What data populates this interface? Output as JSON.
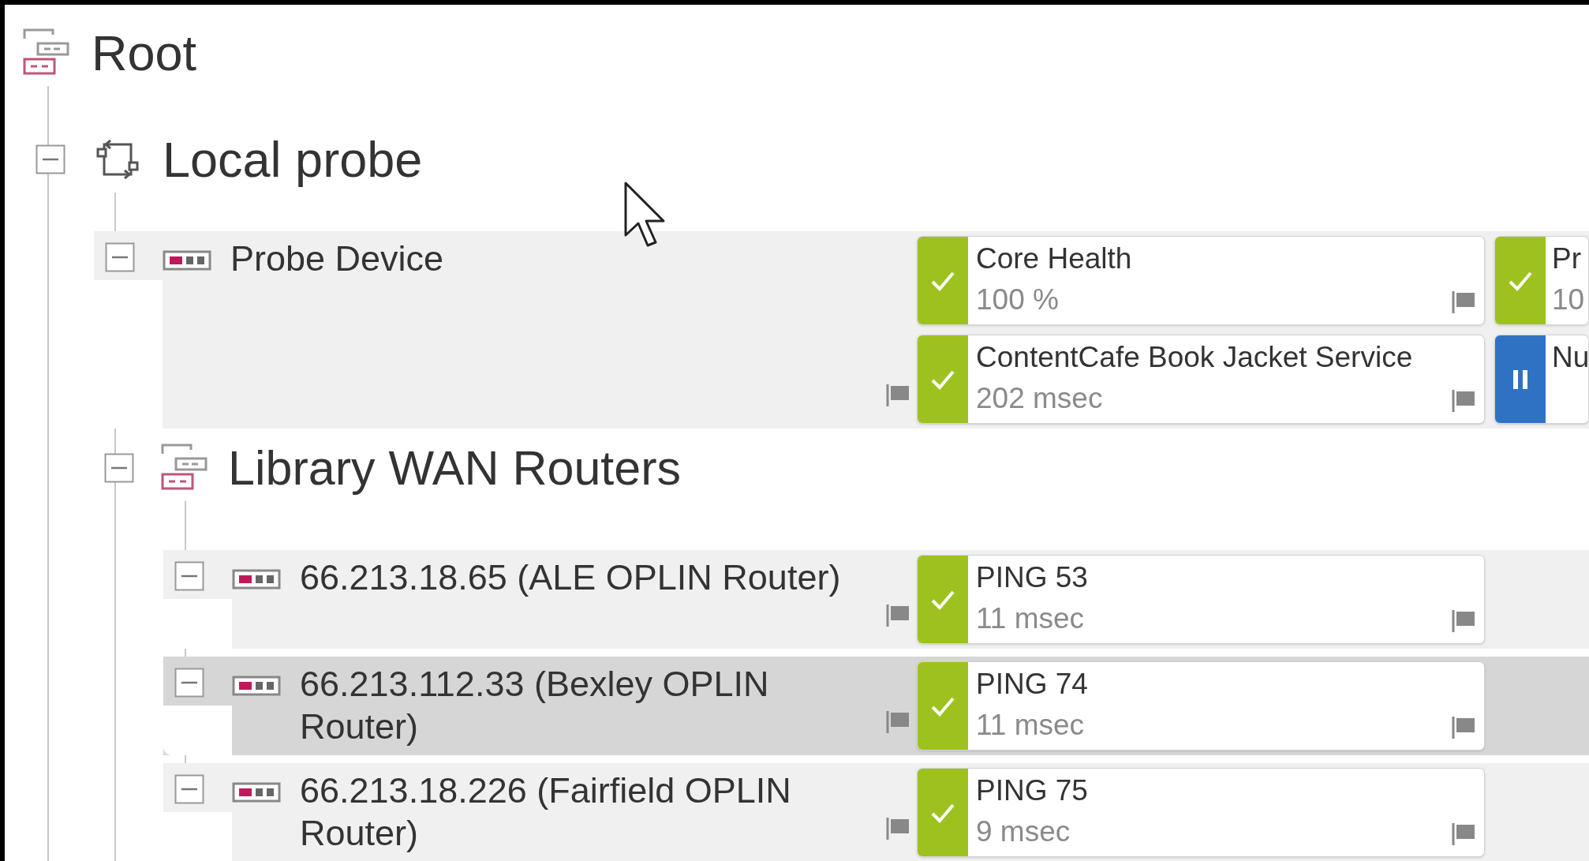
{
  "tree": {
    "label": "Root",
    "kind": "group",
    "selected": false,
    "children": [
      {
        "label": "Local probe",
        "kind": "probe",
        "expanded": true,
        "selected": false,
        "children": [
          {
            "label": "Probe Device",
            "kind": "device",
            "expanded": true,
            "selected": false,
            "sensors": [
              {
                "name": "Core Health",
                "value": "100 %",
                "paused": false
              },
              {
                "name": "Pr",
                "value": "10",
                "paused": false
              },
              {
                "name": "ContentCafe Book Jacket Service",
                "value": "202 msec",
                "paused": false
              },
              {
                "name": "Nu",
                "paused": true
              }
            ]
          },
          {
            "label": "Library WAN Routers",
            "kind": "group",
            "expanded": true,
            "selected": false,
            "children": [
              {
                "label": "66.213.18.65 (ALE OPLIN Router)",
                "kind": "device",
                "expanded": true,
                "selected": false,
                "sensors": [
                  {
                    "name": "PING 53",
                    "value": "11 msec",
                    "paused": false
                  }
                ]
              },
              {
                "label": "66.213.112.33 (Bexley OPLIN Router)",
                "kind": "device",
                "expanded": true,
                "selected": true,
                "sensors": [
                  {
                    "name": "PING 74",
                    "value": "11 msec",
                    "paused": false
                  }
                ]
              },
              {
                "label": "66.213.18.226 (Fairfield OPLIN Router)",
                "kind": "device",
                "expanded": true,
                "selected": false,
                "sensors": [
                  {
                    "name": "PING 75",
                    "value": "9 msec",
                    "paused": false
                  }
                ]
              }
            ]
          }
        ]
      }
    ]
  }
}
